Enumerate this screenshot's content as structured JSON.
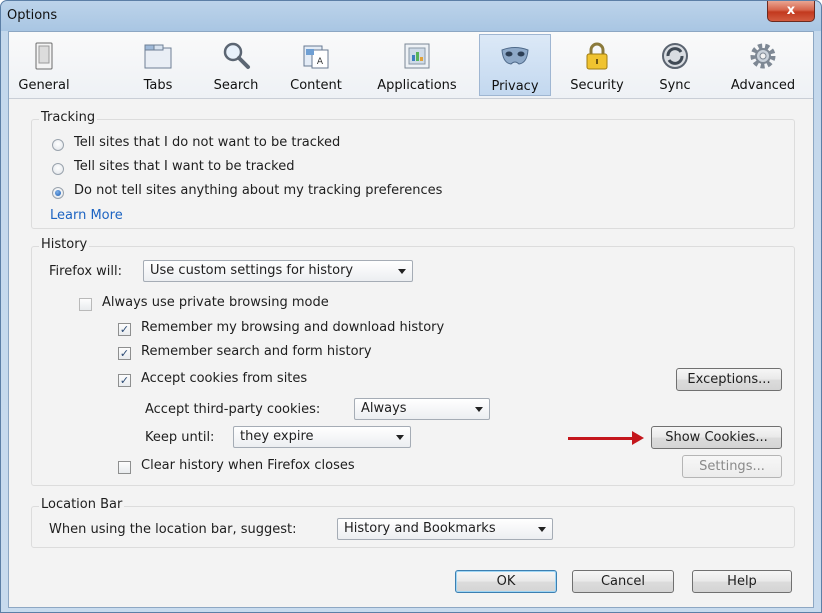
{
  "window": {
    "title": "Options",
    "close_label": "x"
  },
  "toolbar": {
    "tabs": [
      {
        "label": "General",
        "icon": "general-icon"
      },
      {
        "label": "Tabs",
        "icon": "tabs-icon"
      },
      {
        "label": "Search",
        "icon": "search-icon"
      },
      {
        "label": "Content",
        "icon": "content-icon"
      },
      {
        "label": "Applications",
        "icon": "applications-icon"
      },
      {
        "label": "Privacy",
        "icon": "privacy-mask-icon",
        "selected": true
      },
      {
        "label": "Security",
        "icon": "lock-icon"
      },
      {
        "label": "Sync",
        "icon": "sync-icon"
      },
      {
        "label": "Advanced",
        "icon": "gear-icon"
      }
    ]
  },
  "tracking": {
    "title": "Tracking",
    "options": [
      {
        "label": "Tell sites that I do not want to be tracked",
        "selected": false
      },
      {
        "label": "Tell sites that I want to be tracked",
        "selected": false
      },
      {
        "label": "Do not tell sites anything about my tracking preferences",
        "selected": true
      }
    ],
    "learn_more": "Learn More"
  },
  "history": {
    "title": "History",
    "firefox_will_label": "Firefox will:",
    "firefox_will_value": "Use custom settings for history",
    "private_mode_label": "Always use private browsing mode",
    "private_mode_checked": false,
    "remember_browsing_label": "Remember my browsing and download history",
    "remember_browsing_checked": true,
    "remember_search_label": "Remember search and form history",
    "remember_search_checked": true,
    "accept_cookies_label": "Accept cookies from sites",
    "accept_cookies_checked": true,
    "exceptions_button": "Exceptions...",
    "third_party_label": "Accept third-party cookies:",
    "third_party_value": "Always",
    "keep_until_label": "Keep until:",
    "keep_until_value": "they expire",
    "show_cookies_button": "Show Cookies...",
    "clear_history_label": "Clear history when Firefox closes",
    "clear_history_checked": false,
    "settings_button": "Settings..."
  },
  "location_bar": {
    "title": "Location Bar",
    "suggest_label": "When using the location bar, suggest:",
    "suggest_value": "History and Bookmarks"
  },
  "footer": {
    "ok": "OK",
    "cancel": "Cancel",
    "help": "Help"
  },
  "colors": {
    "annotation_arrow": "#c4161c",
    "link": "#1d64c2",
    "title_bar": "#a9c6e3"
  }
}
